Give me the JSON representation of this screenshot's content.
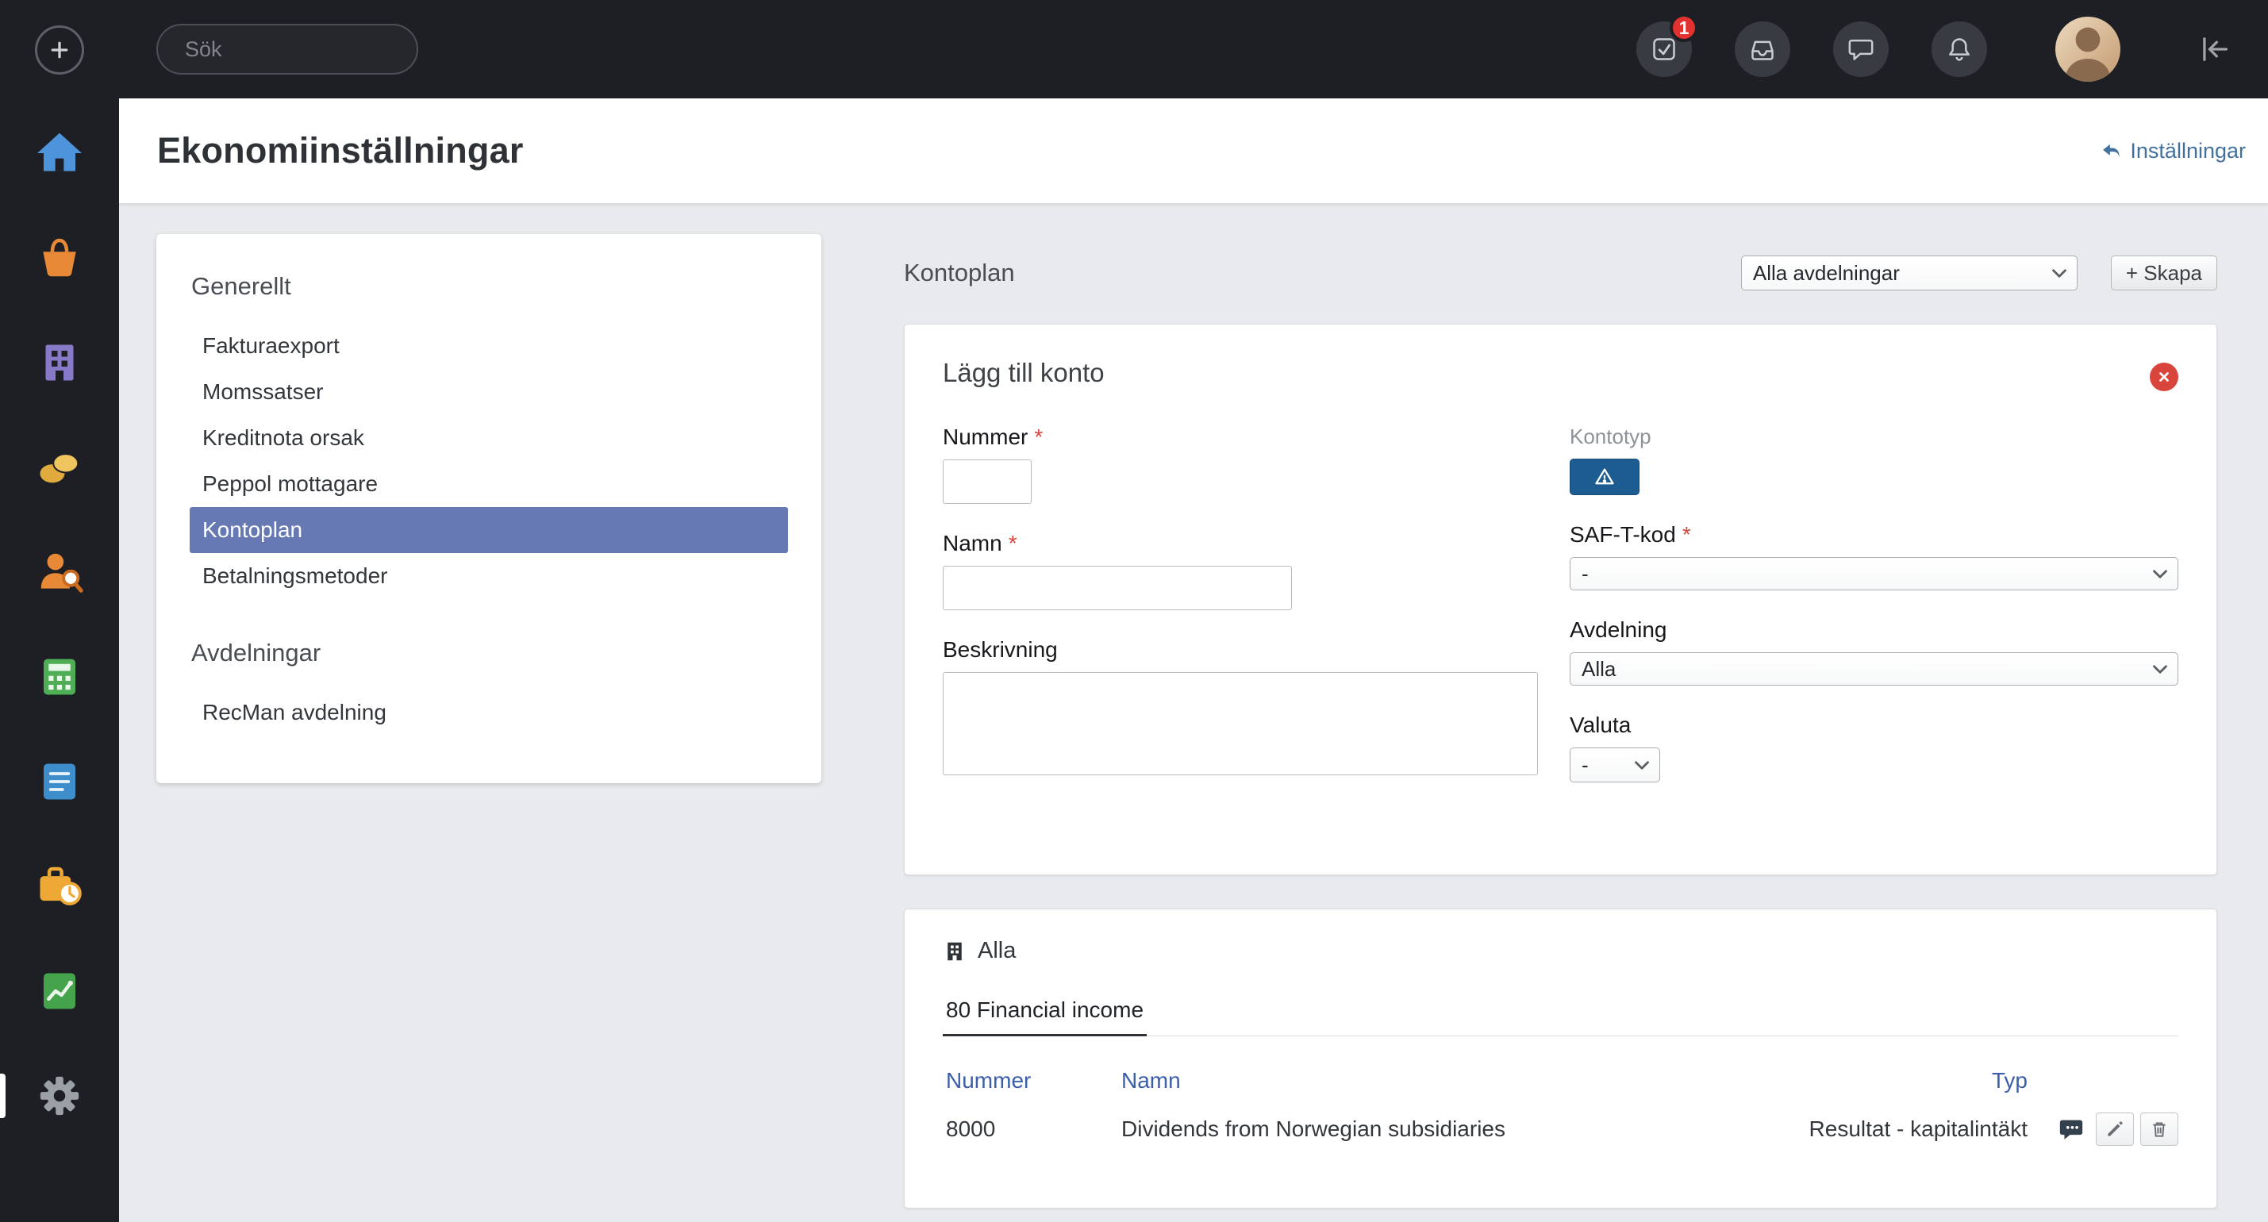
{
  "colors": {
    "topbar_dark": "#1d1f24",
    "accent_selected": "#6779b3",
    "link_blue": "#42719e",
    "table_header_blue": "#3a5fa8",
    "danger_red": "#d9453d",
    "badge_red": "#e23230",
    "kontotyp_button_blue": "#1d5c90",
    "content_background": "#e9eaed"
  },
  "icons": {
    "search-icon": "magnifier",
    "add-icon": "plus-in-circle",
    "home-icon": "blue house",
    "sales-icon": "orange basket",
    "company-icon": "purple building",
    "payroll-icon": "gold coins",
    "recruitment-icon": "orange person with magnifier",
    "accounting-icon": "green calculator",
    "documents-icon": "blue document",
    "time-icon": "orange briefcase with clock",
    "reports-icon": "green line chart",
    "settings-gear-icon": "gray gear",
    "tasks-icon": "checkbox with checkmark",
    "inbox-icon": "tray",
    "chat-icon": "speech bubble",
    "bell-icon": "bell",
    "collapse-icon": "arrow-to-bar-left",
    "reply-icon": "curved back arrow",
    "close-icon": "white x in red circle",
    "warning-icon": "white warning triangle",
    "building-icon": "small dark building",
    "comment-icon": "dark speech bubble with dots",
    "edit-icon": "pencil",
    "delete-icon": "trash can",
    "chevron-down-icon": "select dropdown chevron"
  },
  "topbar": {
    "search_placeholder": "Sök",
    "tasks_badge": "1"
  },
  "page": {
    "title": "Ekonomiinställningar",
    "settings_link": "Inställningar"
  },
  "menu": {
    "sections": [
      {
        "heading": "Generellt",
        "items": [
          {
            "label": "Fakturaexport",
            "selected": false
          },
          {
            "label": "Momssatser",
            "selected": false
          },
          {
            "label": "Kreditnota orsak",
            "selected": false
          },
          {
            "label": "Peppol mottagare",
            "selected": false
          },
          {
            "label": "Kontoplan",
            "selected": true
          },
          {
            "label": "Betalningsmetoder",
            "selected": false
          }
        ]
      },
      {
        "heading": "Avdelningar",
        "items": [
          {
            "label": "RecMan avdelning",
            "selected": false
          }
        ]
      }
    ]
  },
  "kontoplan": {
    "title": "Kontoplan",
    "department_select_value": "Alla avdelningar",
    "create_button": "+ Skapa",
    "form": {
      "title": "Lägg till konto",
      "required_marker": "*",
      "nummer_label": "Nummer",
      "namn_label": "Namn",
      "beskrivning_label": "Beskrivning",
      "kontotyp_label": "Kontotyp",
      "saft_label": "SAF-T-kod",
      "saft_value": "-",
      "avdelning_label": "Avdelning",
      "avdelning_value": "Alla",
      "valuta_label": "Valuta",
      "valuta_value": "-"
    },
    "accounts": {
      "group_label": "Alla",
      "active_tab": "80 Financial income",
      "columns": {
        "nummer": "Nummer",
        "namn": "Namn",
        "typ": "Typ"
      },
      "rows": [
        {
          "nummer": "8000",
          "namn": "Dividends from Norwegian subsidiaries",
          "typ": "Resultat - kapitalintäkt"
        }
      ]
    }
  }
}
